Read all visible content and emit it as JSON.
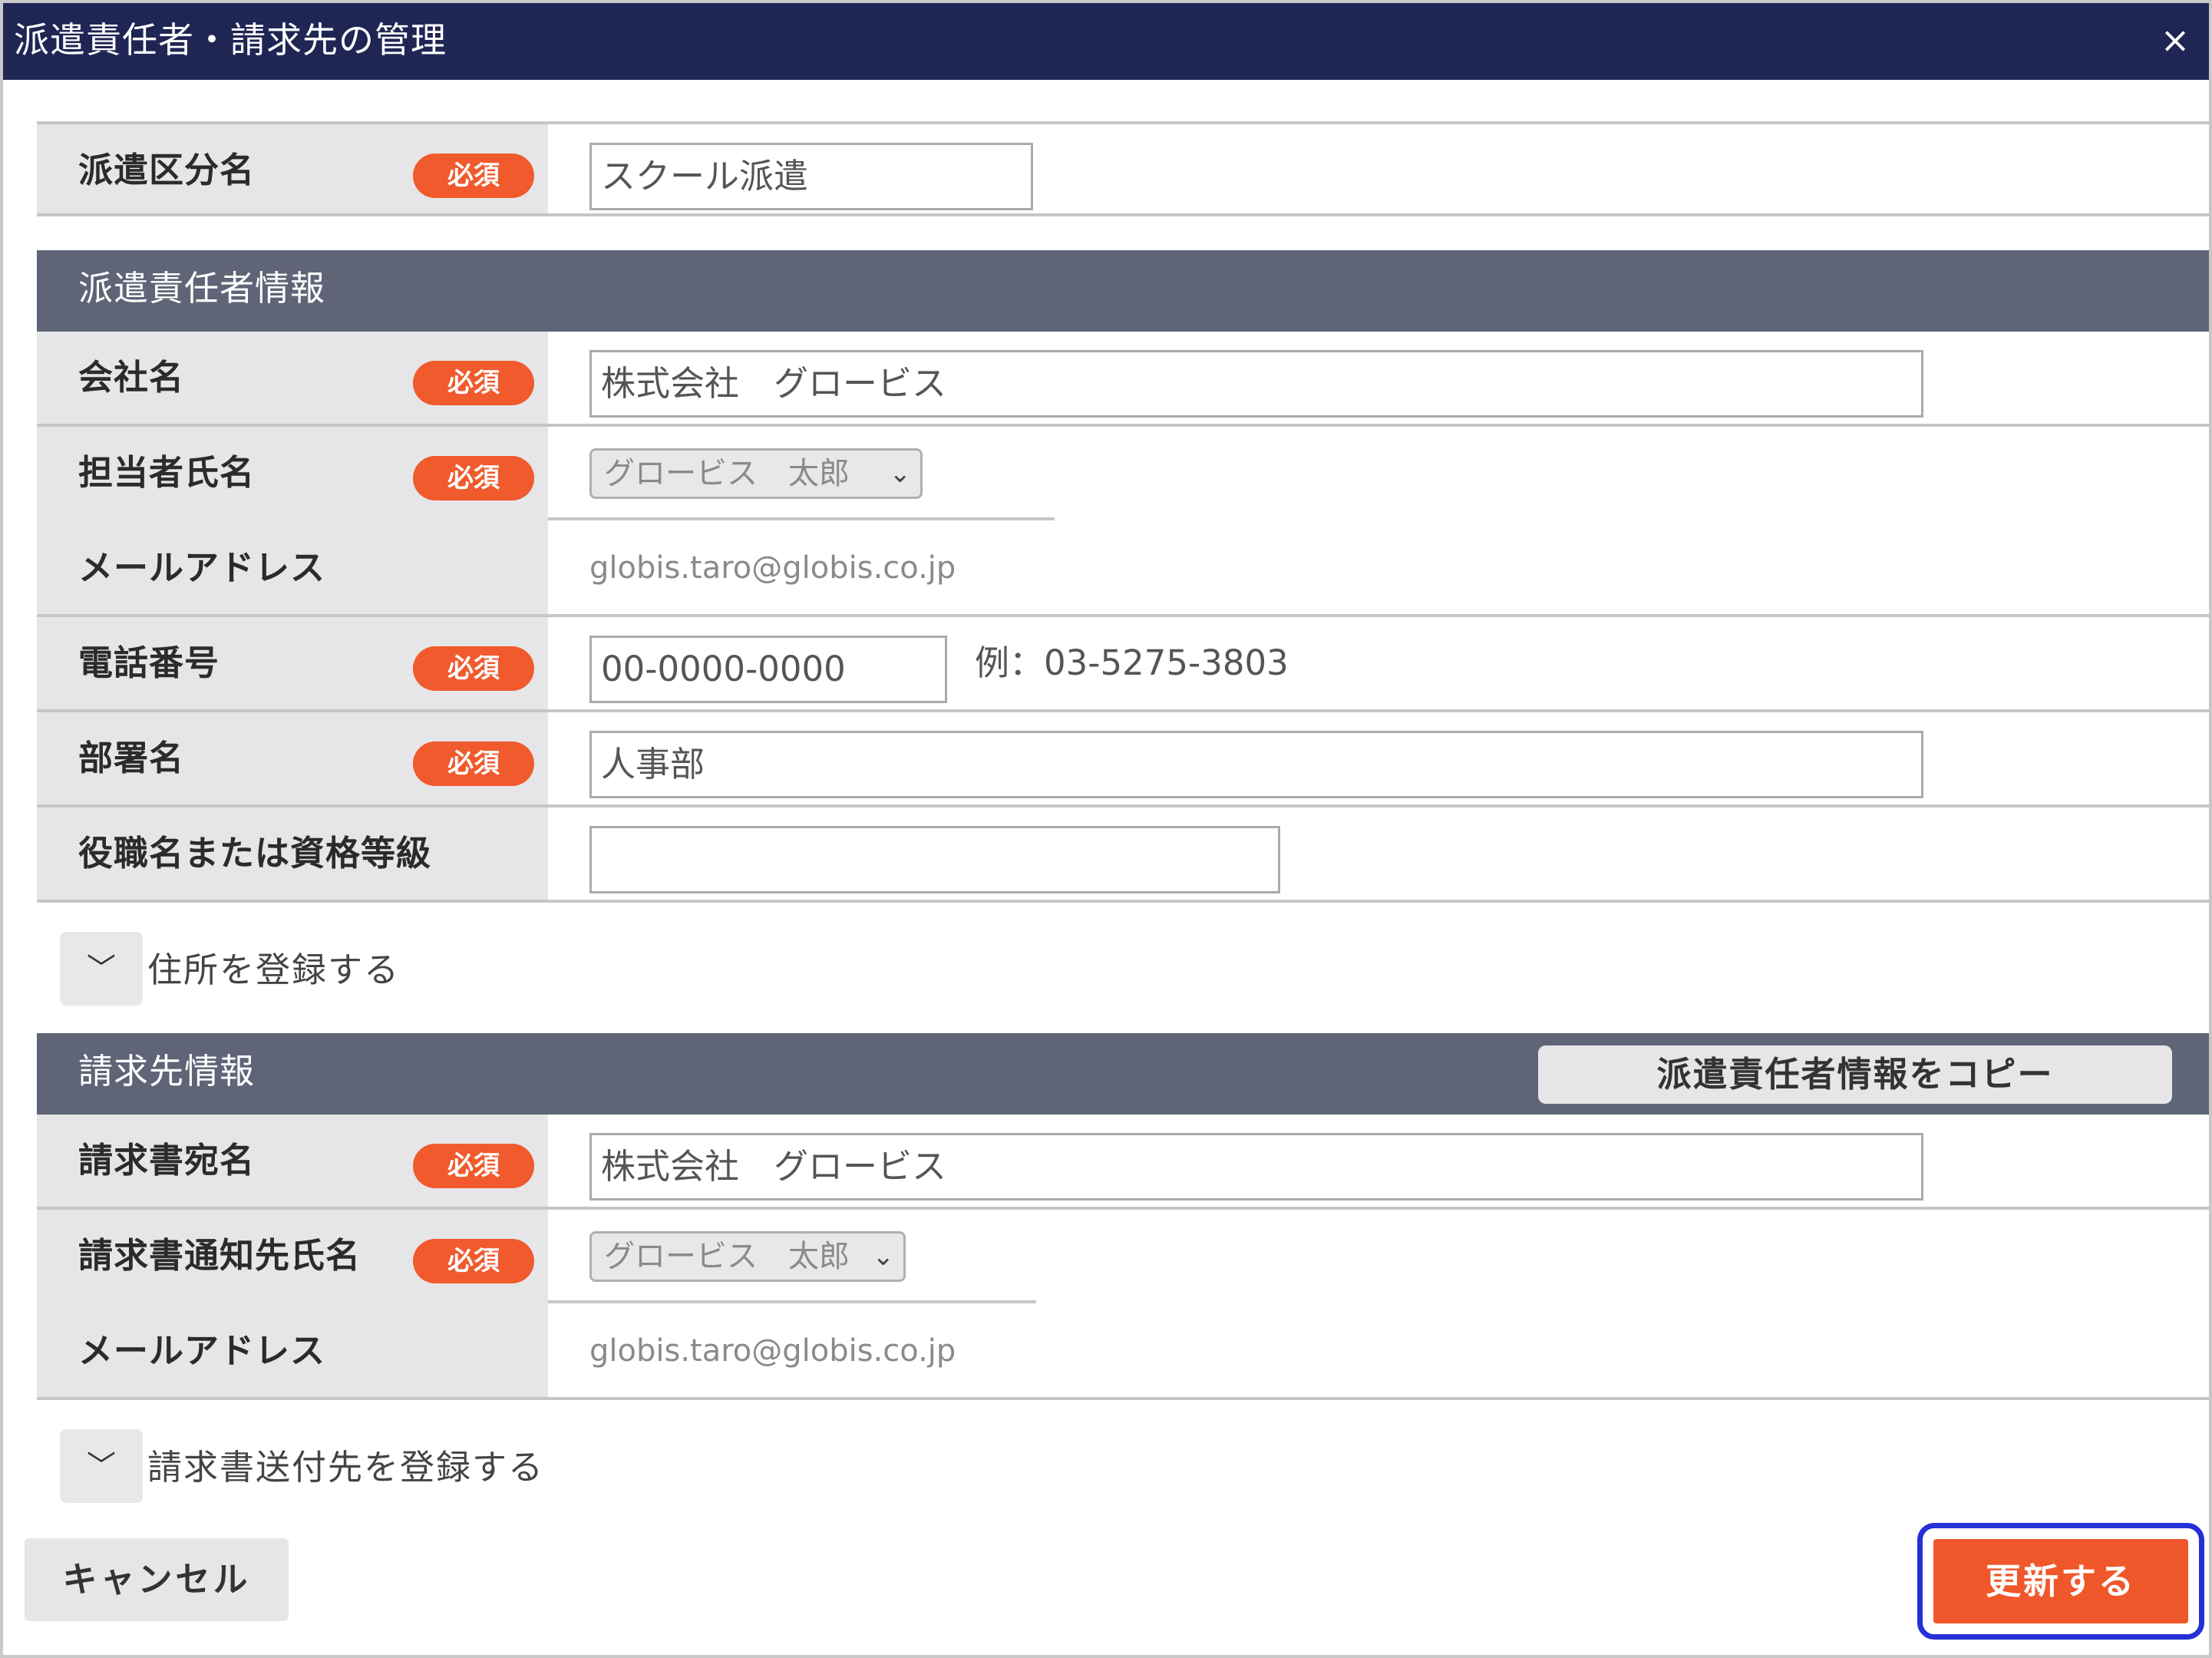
{
  "dialog": {
    "title": "派遣責任者・請求先の管理",
    "close_label": "×"
  },
  "required_badge": "必須",
  "dispatch_type": {
    "label": "派遣区分名",
    "value": "スクール派遣"
  },
  "responsible": {
    "section_title": "派遣責任者情報",
    "company": {
      "label": "会社名",
      "value": "株式会社　グロービス"
    },
    "person": {
      "label": "担当者氏名",
      "selected": "グロービス　太郎"
    },
    "email": {
      "label": "メールアドレス",
      "value": "globis.taro@globis.co.jp"
    },
    "phone": {
      "label": "電話番号",
      "value": "00-0000-0000",
      "hint": "例：03-5275-3803"
    },
    "department": {
      "label": "部署名",
      "value": "人事部"
    },
    "position": {
      "label": "役職名または資格等級",
      "value": ""
    },
    "address_toggle": "住所を登録する"
  },
  "billing": {
    "section_title": "請求先情報",
    "copy_button": "派遣責任者情報をコピー",
    "invoice_name": {
      "label": "請求書宛名",
      "value": "株式会社　グロービス"
    },
    "notify_person": {
      "label": "請求書通知先氏名",
      "selected": "グロービス　太郎"
    },
    "email": {
      "label": "メールアドレス",
      "value": "globis.taro@globis.co.jp"
    },
    "send_toggle": "請求書送付先を登録する"
  },
  "footer": {
    "cancel": "キャンセル",
    "update": "更新する"
  },
  "icons": {
    "close": "close-icon",
    "chevron": "chevron-down-icon"
  }
}
